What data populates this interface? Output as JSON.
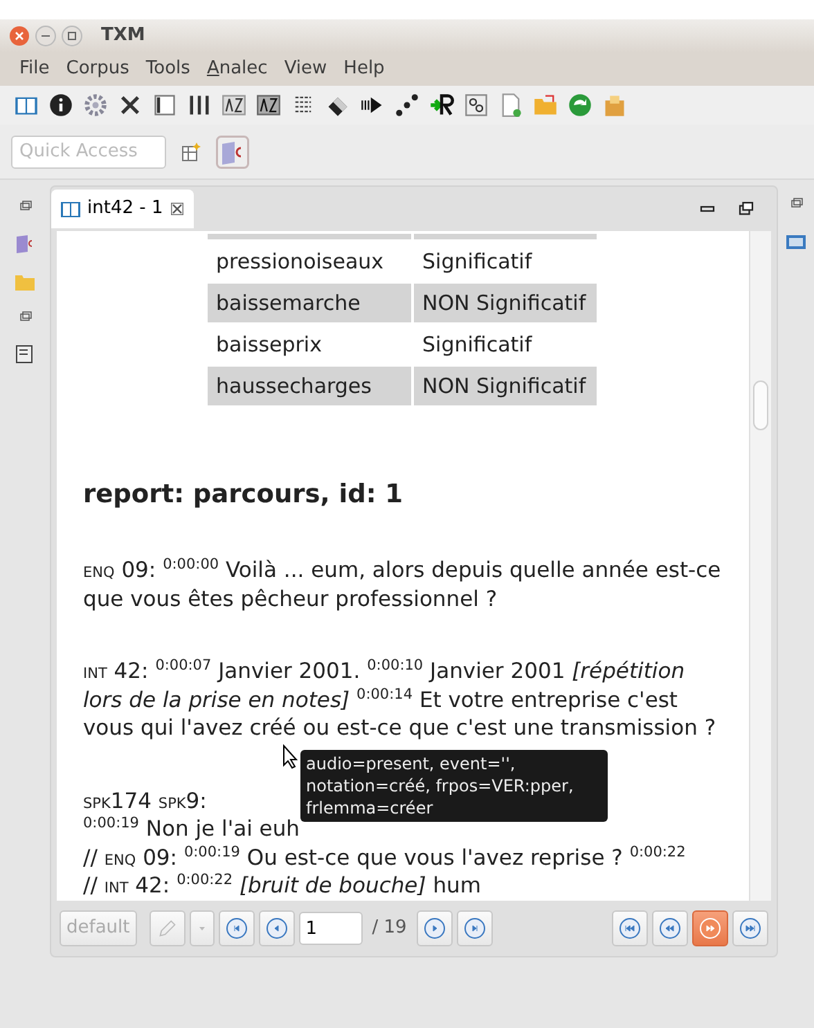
{
  "window": {
    "title": "TXM"
  },
  "menu": [
    {
      "label": "File",
      "mnemonic": false
    },
    {
      "label": "Corpus",
      "mnemonic": false
    },
    {
      "label": "Tools",
      "mnemonic": false
    },
    {
      "label": "Analec",
      "mnemonic": true
    },
    {
      "label": "View",
      "mnemonic": false
    },
    {
      "label": "Help",
      "mnemonic": false
    }
  ],
  "quick_access": {
    "placeholder": "Quick Access"
  },
  "editor_tab": {
    "label": "int42 - 1",
    "selected": true
  },
  "table": {
    "rows": [
      {
        "cells": [
          "",
          ""
        ],
        "shaded": true
      },
      {
        "cells": [
          "pressionoiseaux",
          "Significatif"
        ],
        "shaded": false
      },
      {
        "cells": [
          "baissemarche",
          "NON Significatif"
        ],
        "shaded": true
      },
      {
        "cells": [
          "baisseprix",
          "Significatif"
        ],
        "shaded": false
      },
      {
        "cells": [
          "haussecharges",
          "NON Significatif"
        ],
        "shaded": true
      }
    ]
  },
  "report_heading": "report: parcours, id: 1",
  "utterances": [
    {
      "segments": [
        {
          "kind": "spk",
          "text": "ENQ"
        },
        {
          "kind": "text",
          "text": " 09: "
        },
        {
          "kind": "time",
          "text": "0:00:00"
        },
        {
          "kind": "text",
          "text": " Voilà ... eum, alors depuis quelle année est-ce que vous êtes pêcheur professionnel ?"
        }
      ]
    },
    {
      "segments": [
        {
          "kind": "spk",
          "text": "INT"
        },
        {
          "kind": "text",
          "text": " 42: "
        },
        {
          "kind": "time",
          "text": "0:00:07"
        },
        {
          "kind": "text",
          "text": " Janvier 2001. "
        },
        {
          "kind": "time",
          "text": "0:00:10"
        },
        {
          "kind": "text",
          "text": " Janvier 2001 "
        },
        {
          "kind": "note",
          "text": "[répétition lors de la prise en notes]"
        },
        {
          "kind": "space"
        },
        {
          "kind": "time",
          "text": "0:00:14"
        },
        {
          "kind": "text",
          "text": " Et votre entreprise c'est vous qui l'avez créé ou est-ce que c'est une transmission ?"
        }
      ]
    },
    {
      "segments": [
        {
          "kind": "spk",
          "text": "SPK"
        },
        {
          "kind": "text",
          "text": "174 "
        },
        {
          "kind": "spk",
          "text": "SPK"
        },
        {
          "kind": "text",
          "text": "9:"
        },
        {
          "kind": "break"
        },
        {
          "kind": "time",
          "text": "0:00:19"
        },
        {
          "kind": "text",
          "text": " Non je l'ai euh"
        },
        {
          "kind": "break"
        },
        {
          "kind": "text",
          "text": "// "
        },
        {
          "kind": "spk",
          "text": "ENQ"
        },
        {
          "kind": "text",
          "text": " 09: "
        },
        {
          "kind": "time",
          "text": "0:00:19"
        },
        {
          "kind": "text",
          "text": " Ou est-ce que vous l'avez reprise ? "
        },
        {
          "kind": "time",
          "text": "0:00:22"
        },
        {
          "kind": "break"
        },
        {
          "kind": "text",
          "text": "// "
        },
        {
          "kind": "spk",
          "text": "INT"
        },
        {
          "kind": "text",
          "text": " 42: "
        },
        {
          "kind": "time",
          "text": "0:00:22"
        },
        {
          "kind": "space"
        },
        {
          "kind": "note",
          "text": "[bruit de bouche]"
        },
        {
          "kind": "text",
          "text": " hum"
        }
      ]
    }
  ],
  "tooltip": "audio=present, event='', notation=créé, frpos=VER:pper, frlemma=créer",
  "bottom_bar": {
    "edition_button": {
      "label": "default",
      "disabled": true
    },
    "edit_button": {
      "disabled": true
    },
    "page_field": {
      "value": "1"
    },
    "page_total": "/ 19",
    "page_buttons": [
      {
        "kind": "first",
        "selected": false
      },
      {
        "kind": "prev",
        "selected": false
      },
      {
        "kind": "next",
        "selected": false
      },
      {
        "kind": "last",
        "selected": false
      }
    ],
    "text_buttons": [
      {
        "kind": "first",
        "selected": false
      },
      {
        "kind": "prev",
        "selected": false
      },
      {
        "kind": "next",
        "selected": true
      },
      {
        "kind": "last",
        "selected": false
      }
    ]
  }
}
